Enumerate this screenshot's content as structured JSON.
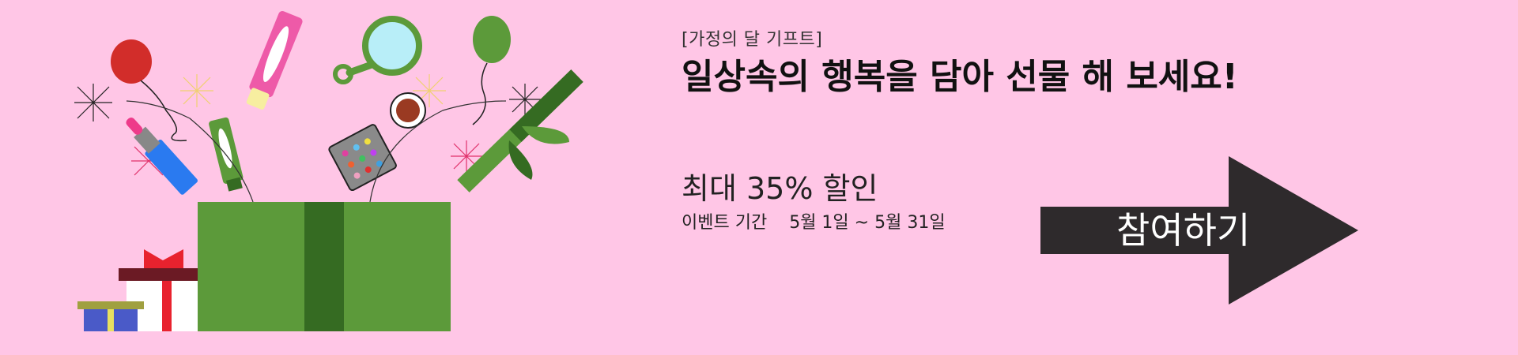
{
  "banner": {
    "eyebrow": "[가정의 달 기프트]",
    "headline": "일상속의 행복을 담아 선물 해 보세요!",
    "discount": "최대 35% 할인",
    "period_label": "이벤트 기간",
    "period_dates": "5월 1일 ~ 5월 31일",
    "cta_label": "참여하기"
  },
  "colors": {
    "background": "#ffc6e6",
    "box_green": "#5c9a3a",
    "ribbon_green": "#356b22",
    "cta_dark": "#2e2a2c"
  },
  "icons": {
    "illustration": "gift-box-with-cosmetics",
    "cta": "arrow-right-icon"
  }
}
